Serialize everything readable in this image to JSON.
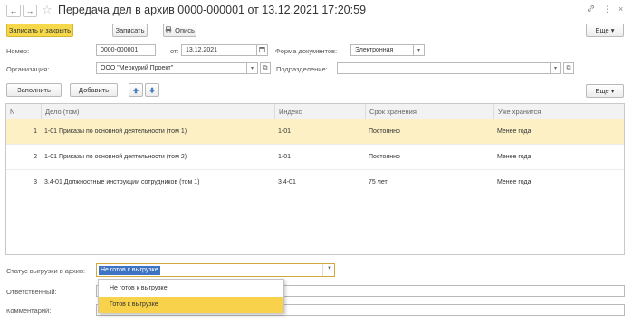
{
  "window": {
    "back_icon": "←",
    "forward_icon": "→",
    "star_icon": "☆",
    "title": "Передача дел в архив 0000-000001 от 13.12.2021 17:20:59",
    "link_icon": "🔗",
    "more_icon": "⋮",
    "close_icon": "×"
  },
  "toolbar": {
    "save_close_label": "Записать и закрыть",
    "save_label": "Записать",
    "inventory_label": "Опись",
    "more_label": "Еще ▾"
  },
  "header": {
    "number_label": "Номер:",
    "number_value": "0000-000001",
    "date_label": "от:",
    "date_value": "13.12.2021",
    "doc_form_label": "Форма документов:",
    "doc_form_value": "Электронная",
    "org_label": "Организация:",
    "org_value": "ООО \"Меркурий Проект\"",
    "dept_label": "Подразделение:",
    "dept_value": ""
  },
  "table_toolbar": {
    "fill_label": "Заполнить",
    "add_label": "Добавить",
    "up_icon": "🡅",
    "down_icon": "🡇",
    "more_label": "Еще ▾"
  },
  "table": {
    "columns": [
      "N",
      "Дело (том)",
      "Индекс",
      "Срок хранения",
      "Уже хранится"
    ],
    "rows": [
      {
        "n": "1",
        "case": "1-01 Приказы по основной деятельности (том 1)",
        "index": "1-01",
        "term": "Постоянно",
        "stored": "Менее года"
      },
      {
        "n": "2",
        "case": "1-01 Приказы по основной деятельности (том 2)",
        "index": "1-01",
        "term": "Постоянно",
        "stored": "Менее года"
      },
      {
        "n": "3",
        "case": "3.4-01 Должностные инструкции сотрудников (том 1)",
        "index": "3.4-01",
        "term": "75 лет",
        "stored": "Менее года"
      }
    ]
  },
  "footer": {
    "status_label": "Статус выгрузки в архив:",
    "status_value": "Не готов к выгрузке",
    "responsible_label": "Ответственный:",
    "comment_label": "Комментарий:",
    "dropdown_options": [
      "Не готов к выгрузке",
      "Готов к выгрузке"
    ]
  },
  "colors": {
    "accent": "#f6d94a",
    "selected_row": "#fdf0c4",
    "highlight": "#3d73c4"
  }
}
